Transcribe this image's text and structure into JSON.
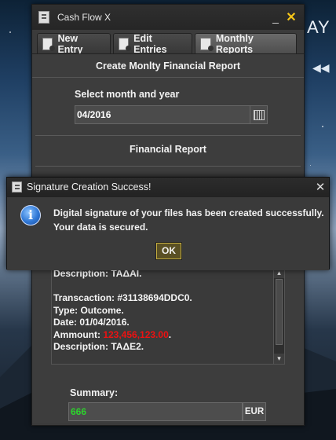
{
  "background": {
    "brand_text": "AY"
  },
  "window": {
    "title": "Cash Flow X",
    "minimize_glyph": "_",
    "close_glyph": "✕",
    "tabs": [
      {
        "label": "New Entry",
        "icon": "document-add-icon"
      },
      {
        "label": "Edit Entries",
        "icon": "document-edit-icon"
      },
      {
        "label": "Monthly Reports",
        "icon": "document-search-icon",
        "active": true
      }
    ]
  },
  "report_form": {
    "heading": "Create Monlty Financial Report",
    "month_label": "Select month and year",
    "month_value": "04/2016",
    "report_heading": "Financial Report"
  },
  "report": {
    "line_description_1": "Description: ΤΑΔΑΙ.",
    "line_transaction": "Transcaction: #31138694DDC0.",
    "line_type": "Type: Outcome.",
    "line_date": "Date: 01/04/2016.",
    "amount_label": "Ammount: ",
    "amount_value": "123,456,123.00",
    "amount_suffix": ".",
    "line_description_2": "Description: ΤΑΔΕ2."
  },
  "summary": {
    "label": "Summary:",
    "value": "666",
    "currency": "EUR"
  },
  "dialog": {
    "title": "Signature Creation Success!",
    "close_glyph": "✕",
    "message_line1": "Digital signature of your files has been created successfully.",
    "message_line2": "Your data is secured.",
    "ok_label": "OK"
  },
  "colors": {
    "amount_red": "#ee1111",
    "summary_green": "#2cd32c",
    "close_yellow": "#f5c518"
  }
}
